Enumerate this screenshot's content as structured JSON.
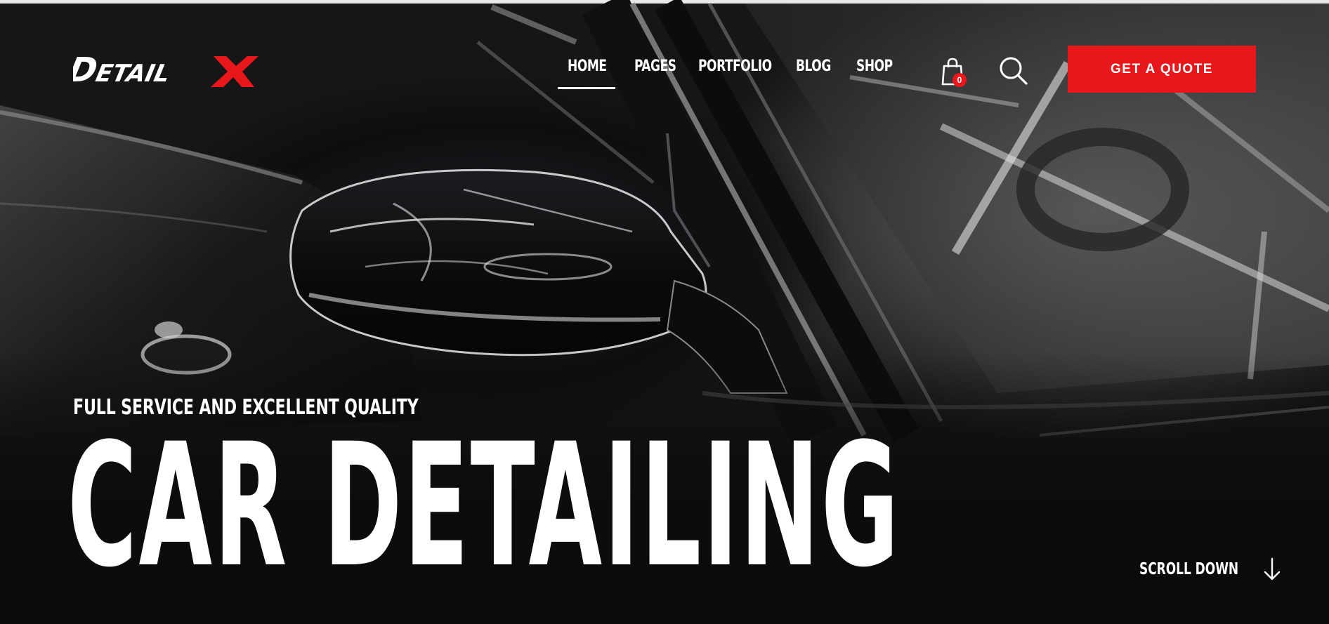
{
  "header": {
    "logo_text": "DetailX",
    "nav": [
      {
        "label": "HOME",
        "active": true
      },
      {
        "label": "PAGES",
        "active": false
      },
      {
        "label": "PORTFOLIO",
        "active": false
      },
      {
        "label": "BLOG",
        "active": false
      },
      {
        "label": "SHOP",
        "active": false
      }
    ],
    "cart_count": "0",
    "cart_icon": "shopping-bag-icon",
    "search_icon": "search-icon",
    "cta_label": "GET A QUOTE"
  },
  "hero": {
    "subtitle": "FULL SERVICE AND EXCELLENT QUALITY",
    "headline": "CAR DETAILING",
    "scroll_label": "SCROLL DOWN",
    "scroll_icon": "arrow-down-icon"
  },
  "colors": {
    "accent": "#e8171b",
    "text": "#ffffff",
    "background": "#0b0b0c"
  }
}
